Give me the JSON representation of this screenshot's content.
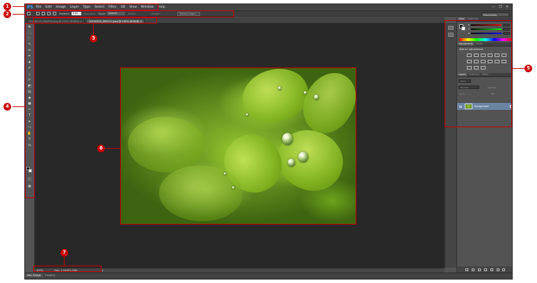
{
  "app": {
    "logo": "PS",
    "menu": [
      "File",
      "Edit",
      "Image",
      "Layer",
      "Type",
      "Select",
      "Filter",
      "3D",
      "View",
      "Window",
      "Help"
    ]
  },
  "options": {
    "feather_label": "Feather:",
    "feather_value": "0 px",
    "antialias": "Anti-alias",
    "style_label": "Style:",
    "style_value": "Normal",
    "width_label": "Width:",
    "height_label": "Height:",
    "refine_edge": "Refine Edge...",
    "workspace": "Essentials"
  },
  "tabs": [
    {
      "label": "20130219_094456.jpeg @ 100% (RGB/8)",
      "close": "×"
    },
    {
      "label": "20130219_095111.jpeg @ 100% (RGB/8)",
      "close": "×"
    }
  ],
  "status": {
    "zoom": "100%",
    "doc": "Doc: 1,04M/1,04M",
    "arrow": "▸"
  },
  "bottom_tabs": [
    "Mini Bridge",
    "Timeline"
  ],
  "panels": {
    "color_tabs": [
      "Color",
      "Swatches"
    ],
    "sliders": [
      "R",
      "G",
      "B"
    ],
    "adj_tabs": [
      "Adjustments",
      "Styles"
    ],
    "adj_title": "Add an adjustment",
    "layer_tabs": [
      "Layers",
      "Channels",
      "Paths"
    ],
    "kind": "Kind",
    "blend": "Normal",
    "opacity": "Opacity:",
    "lock": "Lock:",
    "fill": "Fill:",
    "layer_name": "Background"
  },
  "callouts": [
    "1",
    "2",
    "3",
    "4",
    "5",
    "6",
    "7"
  ],
  "colors": {
    "accent": "#cc0000",
    "ps_blue": "#31a8ff",
    "selected_layer": "#6b84a3"
  }
}
